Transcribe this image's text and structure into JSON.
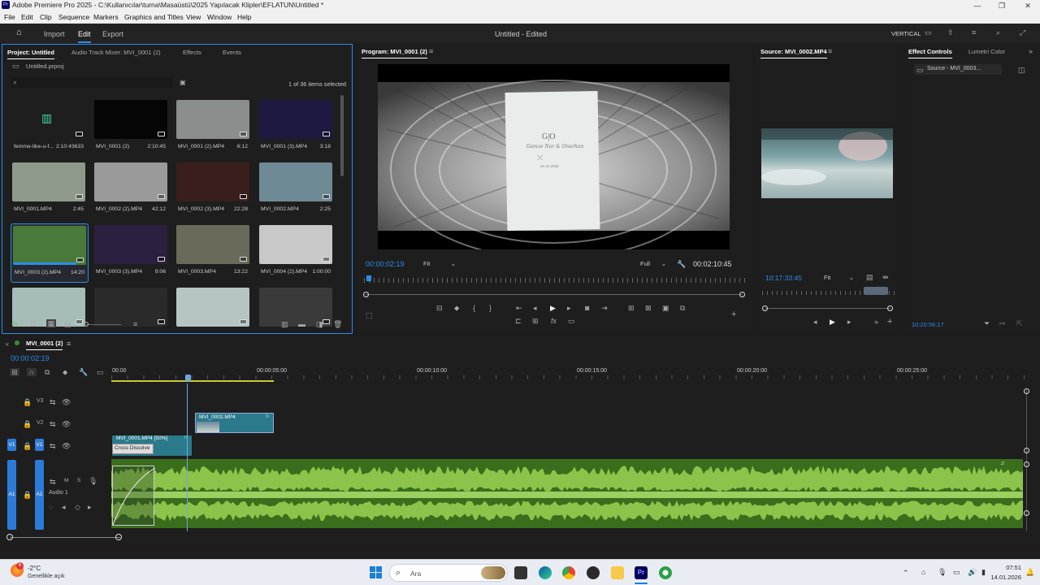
{
  "window": {
    "title": "Adobe Premiere Pro 2025 - C:\\Kullanıcılar\\turna\\Masaüstü\\2025 Yapılacak Klipler\\EFLATUN\\Untitled *",
    "app_icon": "Pr"
  },
  "menu": [
    "File",
    "Edit",
    "Clip",
    "Sequence",
    "Markers",
    "Graphics and Titles",
    "View",
    "Window",
    "Help"
  ],
  "header": {
    "workspaces": [
      "Import",
      "Edit",
      "Export"
    ],
    "active": "Edit",
    "project_title": "Untitled",
    "status": "- Edited",
    "layout": "VERTICAL"
  },
  "project": {
    "tabs": [
      "Project: Untitled",
      "Audio Track Mixer: MVI_0001 (2)",
      "Effects",
      "Events"
    ],
    "file": "Untitled.prproj",
    "selection": "1 of 36 items selected",
    "items": [
      {
        "name": "femme-like-u-f...",
        "dur": "2:10:43633",
        "color": "#1e1e1e",
        "audio": true
      },
      {
        "name": "MVI_0001 (2)",
        "dur": "2:10:45",
        "color": "#050505"
      },
      {
        "name": "MVI_0001 (2).MP4",
        "dur": "6:12",
        "color": "#8a8e8c"
      },
      {
        "name": "MVI_0001 (3).MP4",
        "dur": "3:18",
        "color": "#1c1840"
      },
      {
        "name": "MVI_0001.MP4",
        "dur": "2:45",
        "color": "#8f9a8a"
      },
      {
        "name": "MVI_0002 (2).MP4",
        "dur": "42:12",
        "color": "#9a9a9a"
      },
      {
        "name": "MVI_0002 (3).MP4",
        "dur": "22:28",
        "color": "#3a1e1c"
      },
      {
        "name": "MVI_0002.MP4",
        "dur": "2:25",
        "color": "#6d8a95"
      },
      {
        "name": "MVI_0003 (2).MP4",
        "dur": "14:20",
        "color": "#4a7a3a",
        "selected": true
      },
      {
        "name": "MVI_0003 (3).MP4",
        "dur": "9:06",
        "color": "#2c2040"
      },
      {
        "name": "MVI_0003.MP4",
        "dur": "13:22",
        "color": "#6a6a5a"
      },
      {
        "name": "MVI_0004 (2).MP4",
        "dur": "1:00:00",
        "color": "#c8c8c8"
      },
      {
        "name": "",
        "dur": "",
        "color": "#a6bcb8"
      },
      {
        "name": "",
        "dur": "",
        "color": "#2a2a2a"
      },
      {
        "name": "",
        "dur": "",
        "color": "#b6c4c4"
      },
      {
        "name": "",
        "dur": "",
        "color": "#3a3a3a"
      }
    ]
  },
  "program": {
    "tab": "Program: MVI_0001 (2)",
    "timecode": "00:00:02:19",
    "fit": "Fit",
    "quality": "Full",
    "duration": "00:02:10:45",
    "card_line1": "G|O",
    "card_line2": "Gamze Nur & Onurhan",
    "card_date": "22.12.2025",
    "colors": {
      "timecode": "#2d8ceb"
    }
  },
  "source": {
    "tab": "Source: MVI_0002.MP4",
    "timecode": "10:17:33:45",
    "fit": "Fit"
  },
  "effects": {
    "tabs": [
      "Effect Controls",
      "Lumetri Color"
    ],
    "source_label": "Source - MVI_0003...",
    "timecode": "10:20:56:17"
  },
  "timeline": {
    "tab": "MVI_0001 (2)",
    "timecode": "00:00:02:19",
    "ruler": [
      "00:00",
      "00:00:05:00",
      "00:00:10:00",
      "00:00:15:00",
      "00:00:20:00",
      "00:00:25:00"
    ],
    "tracks": {
      "v3": "V3",
      "v2": "V2",
      "v1": "V1",
      "a1": "A1",
      "a1_name": "Audio 1",
      "src_v1": "V1",
      "src_a1": "A1",
      "mute": "M",
      "solo": "S"
    },
    "clips": {
      "v2": "MVI_0002.MP4",
      "v1": "MVI_0001.MP4 [50%]",
      "transition": "Cross Dissolve",
      "fx": "fx"
    }
  },
  "taskbar": {
    "weather_temp": "-2°C",
    "weather_desc": "Genellikle açık",
    "weather_badge": "6",
    "search": "Ara",
    "time": "07:51",
    "date": "14.01.2026"
  }
}
